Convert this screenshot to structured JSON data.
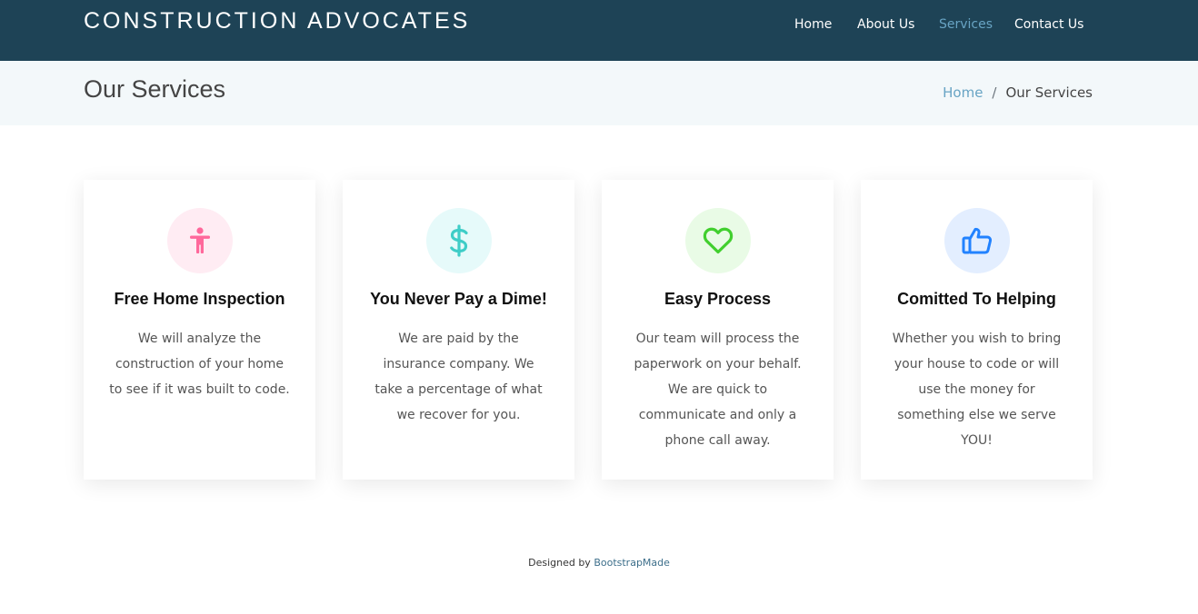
{
  "header": {
    "logo": "CONSTRUCTION ADVOCATES",
    "nav": [
      "Home",
      "About Us",
      "Services",
      "Contact Us"
    ],
    "active_nav": "Services"
  },
  "breadcrumbs": {
    "title": "Our Services",
    "home": "Home",
    "separator": "/",
    "current": "Our Services"
  },
  "services": [
    {
      "title": "Free Home Inspection",
      "text": "We will analyze the construction of your home to see if it was built to code.",
      "icon": "accessibility-person-icon",
      "color": "#ff689b",
      "bg": "#ffecf3"
    },
    {
      "title": "You Never Pay a Dime!",
      "text": "We are paid by the insurance company. We take a percentage of what we recover for you.",
      "icon": "dollar-icon",
      "color": "#3fcdc7",
      "bg": "#e6fafa"
    },
    {
      "title": "Easy Process",
      "text": "Our team will process the paperwork on your behalf. We are quick to communicate and only a phone call away.",
      "icon": "heart-icon",
      "color": "#41cf2e",
      "bg": "#e9fbe6"
    },
    {
      "title": "Comitted To Helping",
      "text": "Whether you wish to bring your house to code or will use the money for something else we serve YOU!",
      "icon": "thumbs-up-icon",
      "color": "#2282ff",
      "bg": "#e3eeff"
    }
  ],
  "footer": {
    "prefix": "Designed by",
    "link": "BootstrapMade"
  }
}
